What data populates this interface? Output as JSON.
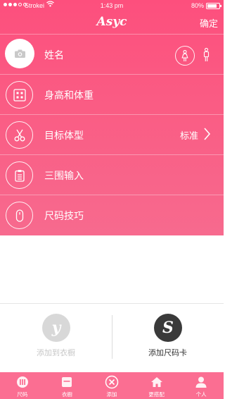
{
  "status_bar": {
    "carrier": "Strokei",
    "time": "1:43 pm",
    "battery": "80%"
  },
  "nav": {
    "logo": "Asyc",
    "confirm_label": "确定"
  },
  "menu": [
    {
      "label": "姓名",
      "icon": "camera-icon"
    },
    {
      "label": "身高和体重",
      "icon": "grid-icon"
    },
    {
      "label": "目标体型",
      "icon": "scissors-icon",
      "value": "标准"
    },
    {
      "label": "三围输入",
      "icon": "clipboard-icon"
    },
    {
      "label": "尺码技巧",
      "icon": "mouse-icon"
    }
  ],
  "cards": [
    {
      "badge": "y",
      "label": "添加到衣橱",
      "badge_color": "#d8d8d8",
      "text_color": "#c7c7c7"
    },
    {
      "badge": "S",
      "label": "添加尺码卡",
      "badge_color": "#3a3a3a",
      "text_color": "#333333"
    }
  ],
  "tabbar": [
    {
      "label": "尺码",
      "icon": "chart-icon"
    },
    {
      "label": "衣橱",
      "icon": "wardrobe-icon"
    },
    {
      "label": "添加",
      "icon": "add-close-icon",
      "active": true
    },
    {
      "label": "更搭配",
      "icon": "home-icon"
    },
    {
      "label": "个人",
      "icon": "person-icon"
    }
  ],
  "colors": {
    "brand": "#fd4f7d",
    "tabbar": "#fb6e92",
    "white": "#ffffff"
  }
}
